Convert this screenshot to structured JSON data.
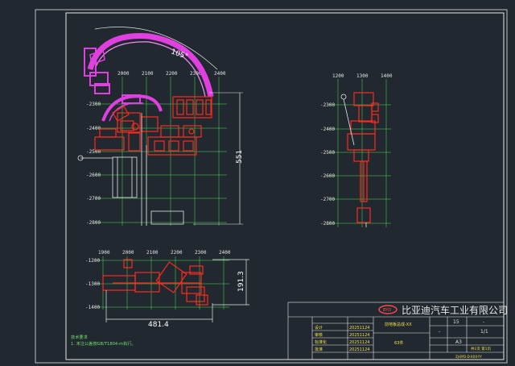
{
  "drawing": {
    "background": "#212830",
    "colors": {
      "border": "#e8e8e8",
      "grid": "#4ee04e",
      "part_red": "#ff2a1e",
      "part_magenta": "#e040e0",
      "dimension": "#e8e8e8",
      "titleblock_text_green": "#6fe06a",
      "titleblock_text_red": "#ff4a4a"
    },
    "front_view": {
      "x_ticks": [
        "2000",
        "2100",
        "2200",
        "2300",
        "2400"
      ],
      "y_ticks": [
        "-2300",
        "-2400",
        "-2500",
        "-2600",
        "-2700",
        "-2800"
      ],
      "angle_dim": "105°",
      "vertical_dim": "551"
    },
    "side_view": {
      "x_ticks": [
        "1200",
        "1300",
        "1400"
      ],
      "y_ticks": [
        "-2300",
        "-2400",
        "-2500",
        "-2600",
        "-2700",
        "-2800"
      ]
    },
    "top_view": {
      "x_ticks": [
        "1900",
        "2000",
        "2100",
        "2200",
        "2300",
        "2400"
      ],
      "y_ticks": [
        "-1200",
        "-1300",
        "-1400"
      ],
      "horizontal_dim": "481.4",
      "vertical_dim": "191.3"
    },
    "notes": {
      "heading": "技术要求",
      "line1": "1. 未注公差按GB/T1804-m执行。"
    },
    "title_block": {
      "company": "比亚迪汽车工业有限公司",
      "logo": "BYD",
      "part_name": "前地板总成-XX",
      "part_sub": "63件",
      "quantity": "15",
      "dash": "-",
      "sheet_size": "A3",
      "scale": "1/1",
      "doc_code": "ZJ-BYD-D-XXX-YY",
      "sheet_label": "共1页 第1页",
      "roles": [
        "设计",
        "审核",
        "标准化",
        "批准"
      ],
      "dates": [
        "20251124",
        "20251124",
        "20251124",
        "20251124"
      ]
    }
  }
}
